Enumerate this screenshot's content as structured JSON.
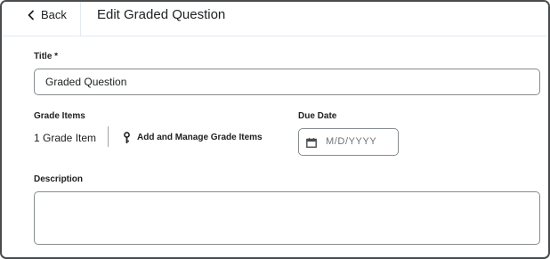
{
  "header": {
    "back_label": "Back",
    "back_icon": "chevron-left-icon",
    "title": "Edit Graded Question"
  },
  "form": {
    "title_label": "Title *",
    "title_value": "Graded Question",
    "grade_items_label": "Grade Items",
    "grade_items_count": "1 Grade Item",
    "manage_link_label": "Add and Manage Grade Items",
    "manage_link_icon": "key-icon",
    "due_date_label": "Due Date",
    "due_date_placeholder": "M/D/YYYY",
    "due_date_icon": "calendar-icon",
    "description_label": "Description",
    "description_value": ""
  },
  "colors": {
    "border": "#868c8f",
    "divider": "#e3e9f1",
    "text": "#202122",
    "placeholder": "#6e7376"
  }
}
